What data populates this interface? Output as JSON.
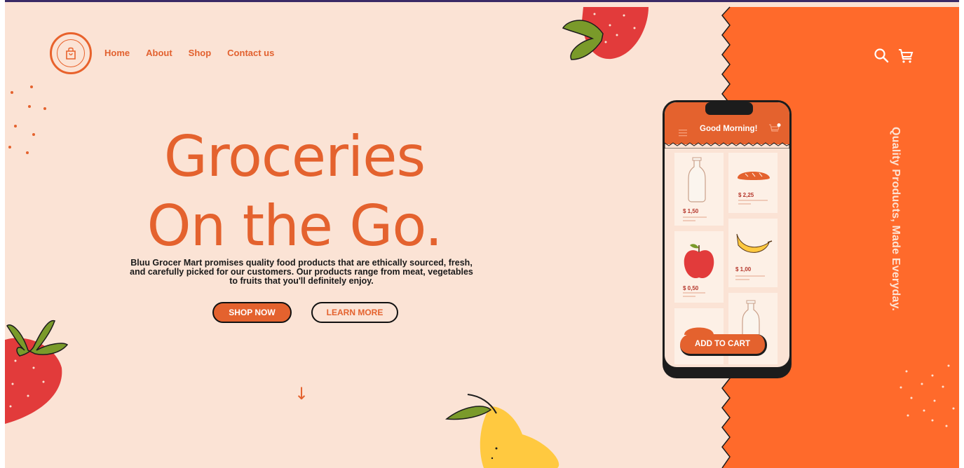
{
  "brand": {
    "logo_icon": "grocery-bag-icon"
  },
  "nav": {
    "items": [
      "Home",
      "About",
      "Shop",
      "Contact us"
    ]
  },
  "header_icons": {
    "search": "search-icon",
    "cart": "cart-icon"
  },
  "hero": {
    "title_line1": "Groceries",
    "title_line2": "On the Go.",
    "description": "Bluu Grocer Mart promises quality food products that are ethically sourced, fresh, and carefully picked for our customers. Our products range from meat, vegetables to fruits that you'll definitely enjoy.",
    "primary_button": "SHOP NOW",
    "secondary_button": "LEARN MORE",
    "scroll_arrow": "↓"
  },
  "side_tagline": "Quality Products, Made Everyday.",
  "phone": {
    "greeting": "Good Morning!",
    "products": [
      {
        "name": "milk-bottle",
        "price": "$ 1,50"
      },
      {
        "name": "bread",
        "price": "$ 2,25"
      },
      {
        "name": "apple",
        "price": "$ 0,50"
      },
      {
        "name": "banana",
        "price": "$ 1,00"
      }
    ],
    "add_to_cart": "ADD TO CART"
  },
  "colors": {
    "accent": "#e4622e",
    "panel": "#ff6a2b",
    "background": "#fbe3d5",
    "text_dark": "#1a1a1a"
  }
}
